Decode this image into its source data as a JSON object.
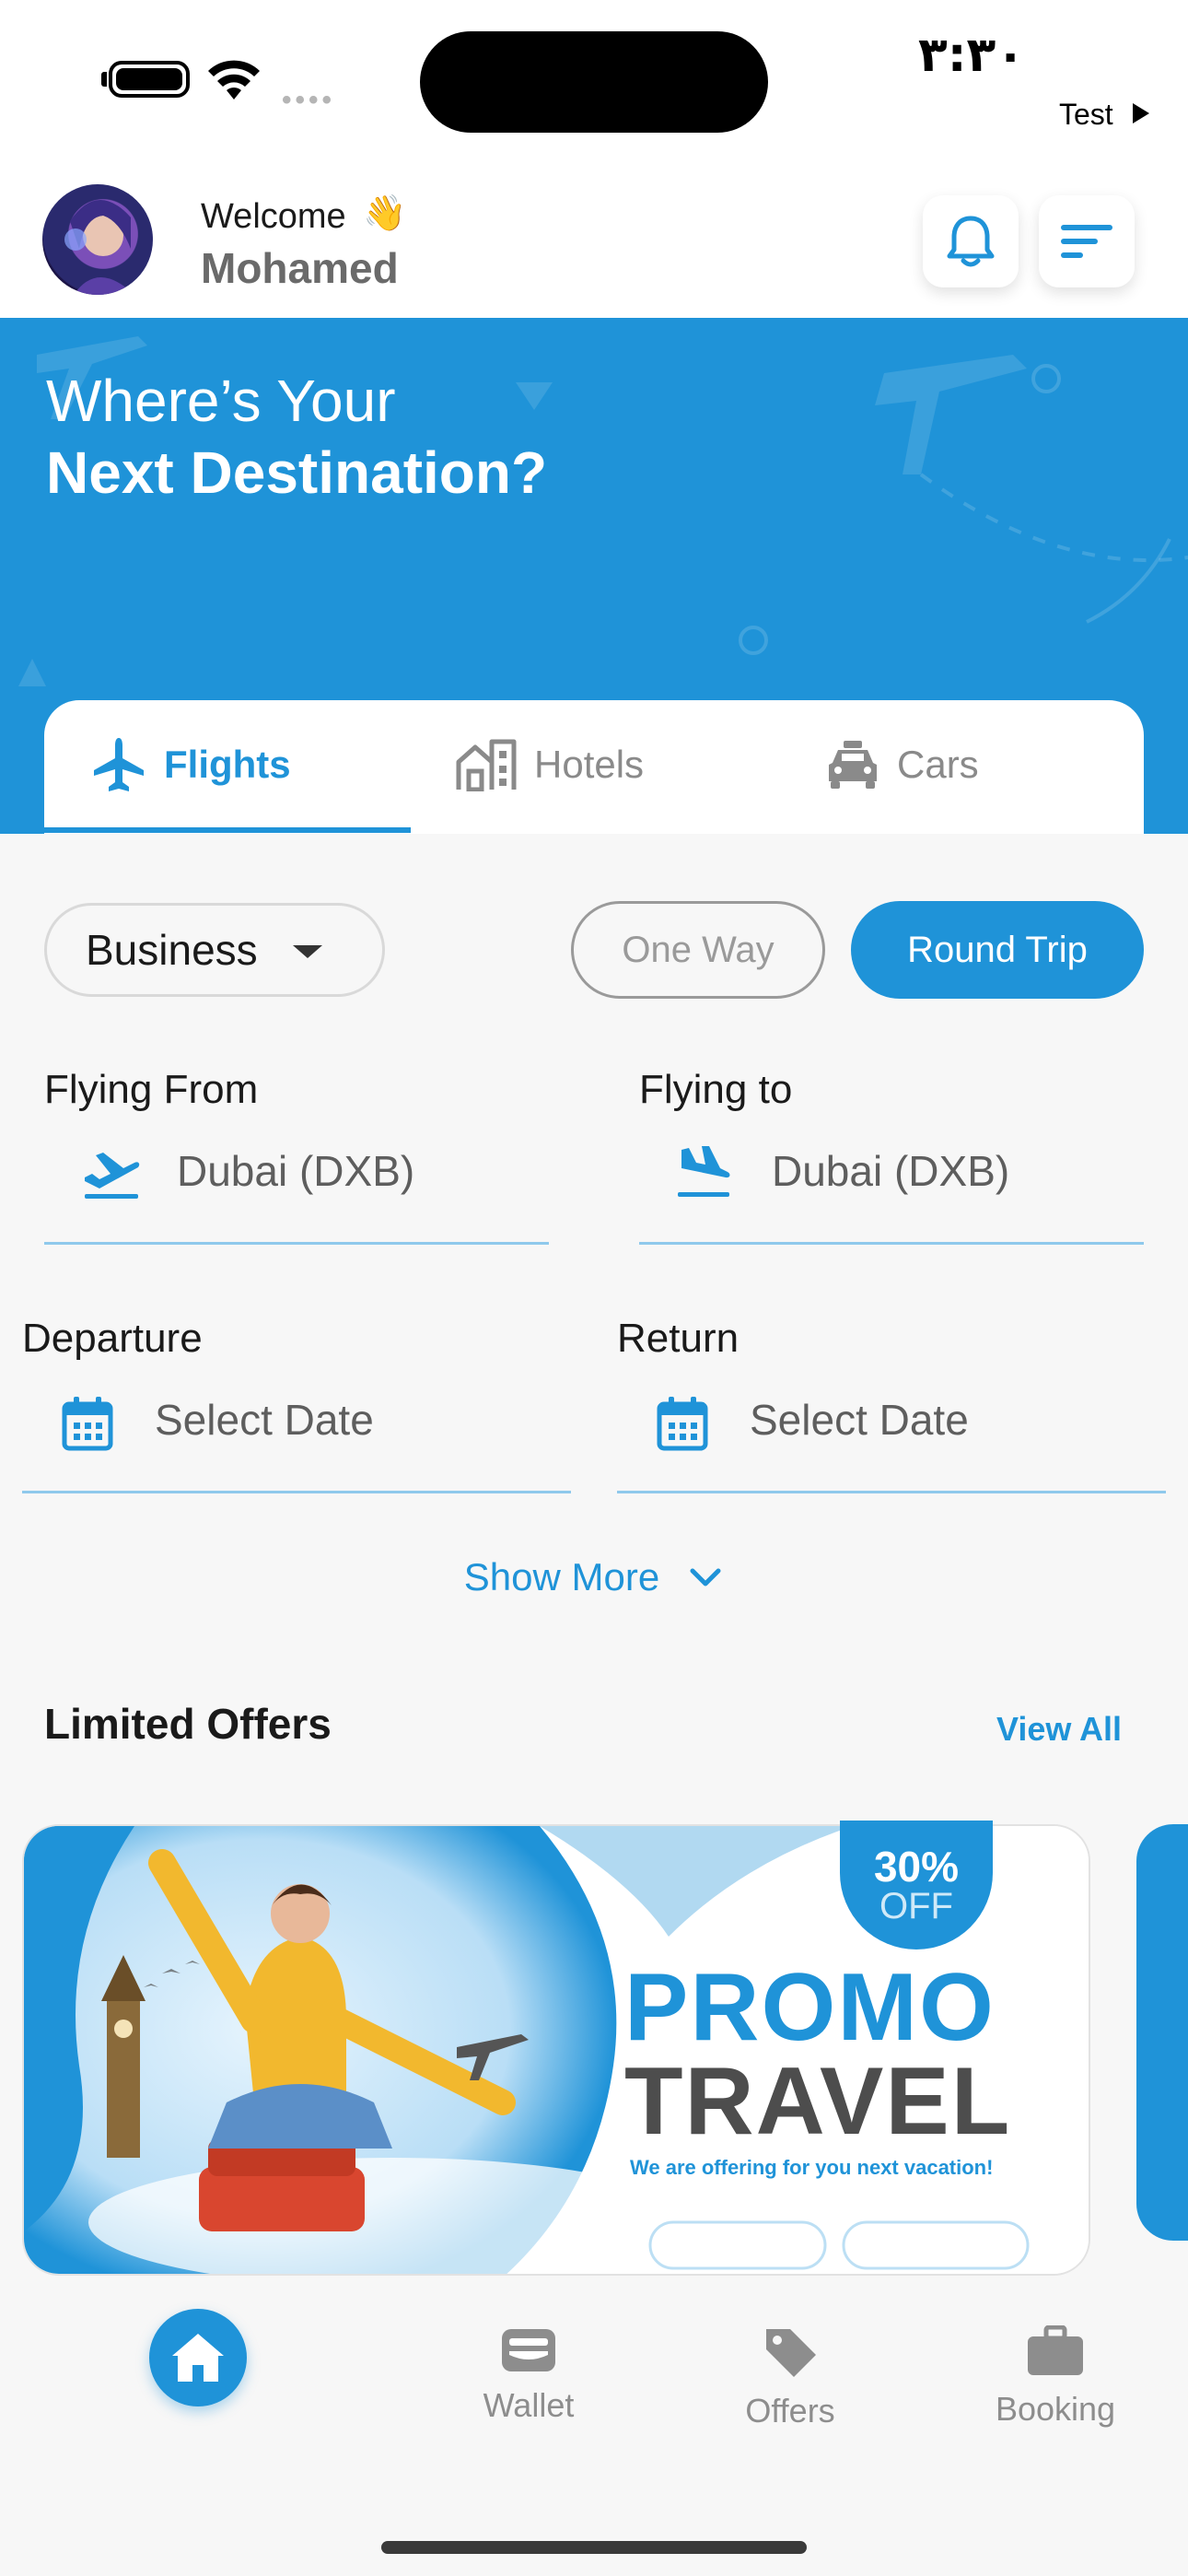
{
  "status_bar": {
    "time": "٣:٣٠",
    "carrier": "Test"
  },
  "header": {
    "welcome": "Welcome",
    "wave_emoji": "👋",
    "username": "Mohamed",
    "avatar_icon": "avatar",
    "bell_icon": "bell-icon",
    "menu_icon": "filter-menu-icon"
  },
  "hero": {
    "line1": "Where’s Your",
    "line2": "Next Destination?"
  },
  "tabs": [
    {
      "label": "Flights",
      "icon": "airplane-icon",
      "active": true
    },
    {
      "label": "Hotels",
      "icon": "hotel-icon",
      "active": false
    },
    {
      "label": "Cars",
      "icon": "car-icon",
      "active": false
    }
  ],
  "search": {
    "cabin_class": "Business",
    "trip_types": [
      {
        "label": "One Way",
        "selected": false
      },
      {
        "label": "Round Trip",
        "selected": true
      }
    ],
    "from": {
      "label": "Flying From",
      "value": "Dubai (DXB)"
    },
    "to": {
      "label": "Flying to",
      "value": "Dubai (DXB)"
    },
    "departure": {
      "label": "Departure",
      "placeholder": "Select Date"
    },
    "return": {
      "label": "Return",
      "placeholder": "Select Date"
    },
    "show_more": "Show More"
  },
  "offers": {
    "title": "Limited Offers",
    "view_all": "View All",
    "banner": {
      "badge_percent": "30%",
      "badge_off": "OFF",
      "title1": "PROMO",
      "title2": "TRAVEL",
      "subtitle": "We are offering for you next vacation!"
    }
  },
  "bottom_nav": [
    {
      "label": "",
      "icon": "home-icon",
      "active": true
    },
    {
      "label": "Wallet",
      "icon": "wallet-icon",
      "active": false
    },
    {
      "label": "Offers",
      "icon": "tag-icon",
      "active": false
    },
    {
      "label": "Booking",
      "icon": "briefcase-icon",
      "active": false
    }
  ],
  "colors": {
    "primary": "#1f93d8",
    "background": "#f7f7f7",
    "muted": "#8d8d8d"
  }
}
